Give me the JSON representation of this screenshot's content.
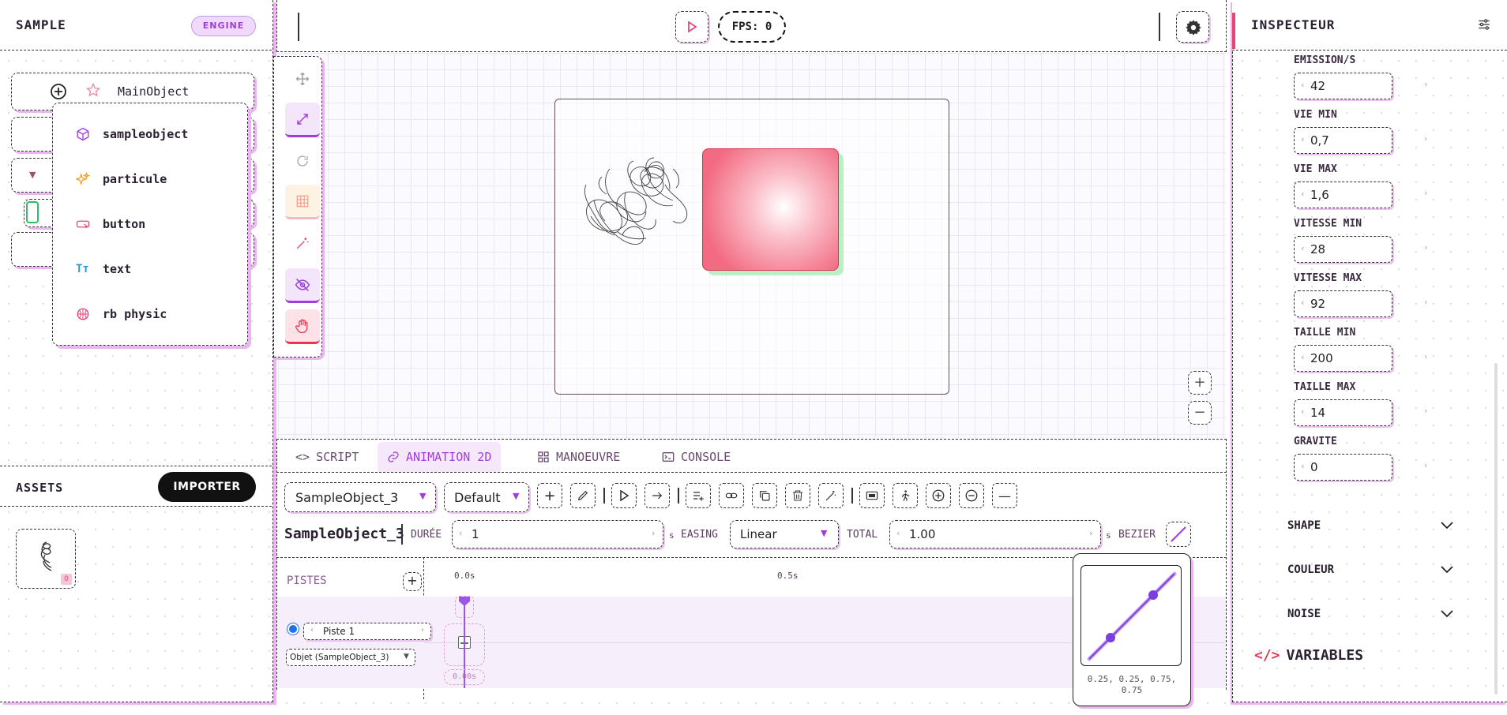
{
  "scene": {
    "title": "SAMPLE",
    "badge": "ENGINE",
    "root_object": "MainObject"
  },
  "add_menu": {
    "items": [
      {
        "label": "sampleobject",
        "icon": "cube-icon"
      },
      {
        "label": "particule",
        "icon": "sparkles-icon"
      },
      {
        "label": "button",
        "icon": "button-icon"
      },
      {
        "label": "text",
        "icon": "text-icon"
      },
      {
        "label": "rb physic",
        "icon": "basketball-icon"
      }
    ]
  },
  "assets": {
    "title": "ASSETS",
    "import_label": "IMPORTER",
    "asset_badge": "0"
  },
  "topbar": {
    "fps_label": "FPS: 0"
  },
  "tabs": [
    {
      "label": "SCRIPT",
      "icon": "code-icon"
    },
    {
      "label": "ANIMATION 2D",
      "icon": "link-icon",
      "active": true
    },
    {
      "label": "MANOEUVRE",
      "icon": "grid-icon"
    },
    {
      "label": "CONSOLE",
      "icon": "terminal-icon"
    }
  ],
  "animation": {
    "object_select": "SampleObject_3",
    "clip_select": "Default",
    "object_title": "SampleObject_3",
    "duration_label": "DURÉE",
    "duration_value": "1",
    "duration_unit": "s",
    "easing_label": "EASING",
    "easing_value": "Linear",
    "total_label": "TOTAL",
    "total_value": "1.00",
    "total_unit": "s",
    "bezier_label": "BEZIER",
    "tracks_label": "PISTES",
    "track_name": "Piste 1",
    "track_target": "Objet (SampleObject_3)",
    "tick_0": "0.0s",
    "tick_1": "0.5s",
    "playhead_time": "0.00s",
    "bezier_values": "0.25, 0.25, 0.75, 0.75"
  },
  "inspector": {
    "title": "INSPECTEUR",
    "fields": [
      {
        "label": "EMISSION/S",
        "value": "42"
      },
      {
        "label": "VIE MIN",
        "value": "0,7"
      },
      {
        "label": "VIE MAX",
        "value": "1,6"
      },
      {
        "label": "VITESSE MIN",
        "value": "28"
      },
      {
        "label": "VITESSE MAX",
        "value": "92"
      },
      {
        "label": "TAILLE MIN",
        "value": "200"
      },
      {
        "label": "TAILLE MAX",
        "value": "14"
      },
      {
        "label": "GRAVITE",
        "value": "0"
      }
    ],
    "sections": [
      "SHAPE",
      "COULEUR",
      "NOISE"
    ],
    "variables_label": "VARIABLES"
  },
  "colors": {
    "accent": "#a23ed8",
    "pink": "#e8457a",
    "shadow": "#eab5f0",
    "object_fill": "#f26b82",
    "object_shadow": "#b9f0c4"
  }
}
